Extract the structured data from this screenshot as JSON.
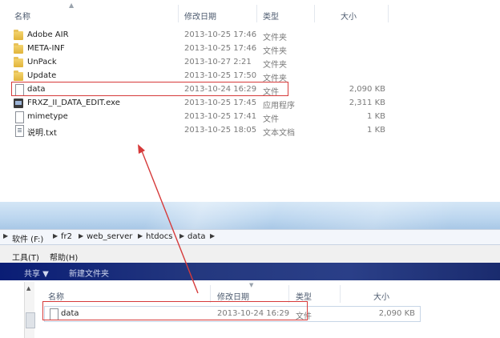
{
  "top": {
    "columns": {
      "name": "名称",
      "date": "修改日期",
      "type": "类型",
      "size": "大小"
    },
    "rows": [
      {
        "icon": "folder-icon",
        "name": "Adobe AIR",
        "date": "2013-10-25 17:46",
        "type": "文件夹",
        "size": ""
      },
      {
        "icon": "folder-icon",
        "name": "META-INF",
        "date": "2013-10-25 17:46",
        "type": "文件夹",
        "size": ""
      },
      {
        "icon": "folder-icon",
        "name": "UnPack",
        "date": "2013-10-27 2:21",
        "type": "文件夹",
        "size": ""
      },
      {
        "icon": "folder-icon",
        "name": "Update",
        "date": "2013-10-25 17:50",
        "type": "文件夹",
        "size": ""
      },
      {
        "icon": "file-icon",
        "name": "data",
        "date": "2013-10-24 16:29",
        "type": "文件",
        "size": "2,090 KB"
      },
      {
        "icon": "exe-icon",
        "name": "FRXZ_II_DATA_EDIT.exe",
        "date": "2013-10-25 17:45",
        "type": "应用程序",
        "size": "2,311 KB"
      },
      {
        "icon": "file-icon",
        "name": "mimetype",
        "date": "2013-10-25 17:41",
        "type": "文件",
        "size": "1 KB"
      },
      {
        "icon": "text-file-icon",
        "name": "说明.txt",
        "date": "2013-10-25 18:05",
        "type": "文本文档",
        "size": "1 KB"
      }
    ]
  },
  "address": {
    "crumbs": [
      "软件 (F:)",
      "fr2",
      "web_server",
      "htdocs",
      "data"
    ]
  },
  "menu": {
    "tools": "工具(T)",
    "help": "帮助(H)"
  },
  "commands": {
    "share": "共享 ▼",
    "new_folder": "新建文件夹"
  },
  "bottom": {
    "columns": {
      "name": "名称",
      "date": "修改日期",
      "type": "类型",
      "size": "大小"
    },
    "row": {
      "name": "data",
      "date": "2013-10-24 16:29",
      "type": "文件",
      "size": "2,090 KB"
    }
  },
  "colors": {
    "highlight": "#d63a3a",
    "command_bar": "#1a2b6e"
  }
}
